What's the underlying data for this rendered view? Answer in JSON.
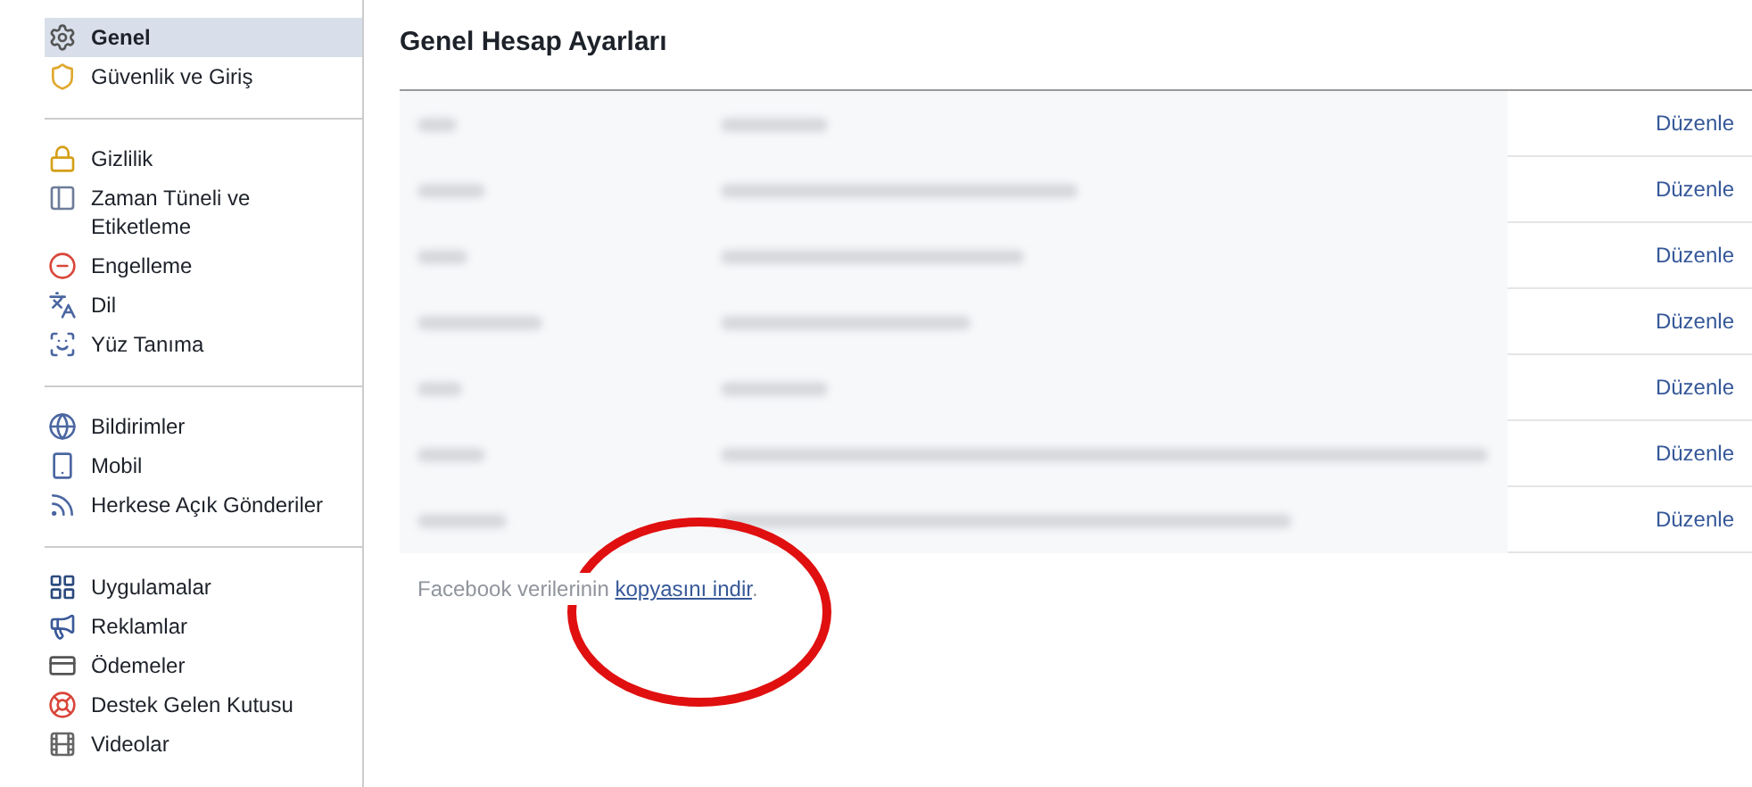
{
  "sidebar": {
    "groups": [
      {
        "items": [
          {
            "label": "Genel",
            "selected": true
          },
          {
            "label": "Güvenlik ve Giriş",
            "selected": false
          }
        ]
      },
      {
        "items": [
          {
            "label": "Gizlilik",
            "selected": false
          },
          {
            "label": "Zaman Tüneli ve Etiketleme",
            "selected": false
          },
          {
            "label": "Engelleme",
            "selected": false
          },
          {
            "label": "Dil",
            "selected": false
          },
          {
            "label": "Yüz Tanıma",
            "selected": false
          }
        ]
      },
      {
        "items": [
          {
            "label": "Bildirimler",
            "selected": false
          },
          {
            "label": "Mobil",
            "selected": false
          },
          {
            "label": "Herkese Açık Gönderiler",
            "selected": false
          }
        ]
      },
      {
        "items": [
          {
            "label": "Uygulamalar",
            "selected": false
          },
          {
            "label": "Reklamlar",
            "selected": false
          },
          {
            "label": "Ödemeler",
            "selected": false
          },
          {
            "label": "Destek Gelen Kutusu",
            "selected": false
          },
          {
            "label": "Videolar",
            "selected": false
          }
        ]
      }
    ]
  },
  "main": {
    "title": "Genel Hesap Ayarları",
    "rows": [
      {
        "action": "Düzenle"
      },
      {
        "action": "Düzenle"
      },
      {
        "action": "Düzenle"
      },
      {
        "action": "Düzenle"
      },
      {
        "action": "Düzenle"
      },
      {
        "action": "Düzenle"
      },
      {
        "action": "Düzenle"
      }
    ],
    "footer": {
      "text": "Facebook verilerinin",
      "link": "kopyasını indir",
      "end": "."
    }
  }
}
